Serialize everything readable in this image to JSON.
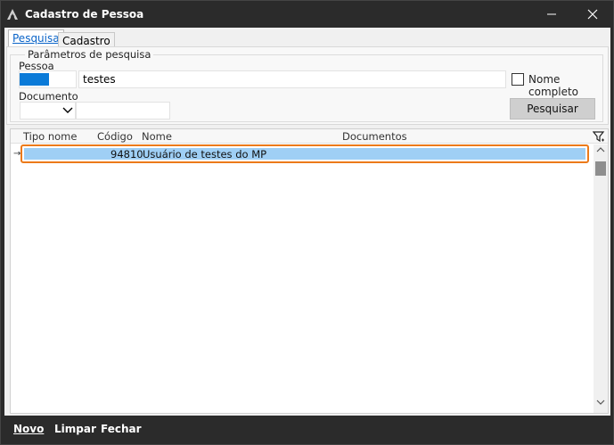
{
  "window": {
    "title": "Cadastro de Pessoa",
    "minimize_glyph": "—",
    "close_glyph": "✕"
  },
  "tabs": [
    {
      "label": "Pesquisa",
      "active": true
    },
    {
      "label": "Cadastro",
      "active": false
    }
  ],
  "search": {
    "group_title": "Parâmetros de pesquisa",
    "pessoa_label": "Pessoa",
    "pessoa_value": "testes",
    "documento_label": "Documento",
    "documento_value": "",
    "nome_completo_label": "Nome completo",
    "nome_completo_checked": false,
    "search_button": "Pesquisar"
  },
  "grid": {
    "columns": [
      "Tipo nome",
      "Código",
      "Nome",
      "Documentos"
    ],
    "rows": [
      {
        "tipo_nome": "",
        "codigo": "94810",
        "nome": "Usuário de testes do MP",
        "documentos": ""
      }
    ],
    "current_row_marker": "→"
  },
  "footer": {
    "novo": "Novo",
    "limpar": "Limpar",
    "fechar": "Fechar"
  },
  "colors": {
    "accent": "#0a7ad8",
    "selected_row": "#9fcff5",
    "focus_border": "#ec7a1a",
    "titlebar": "#2b2b2b"
  }
}
